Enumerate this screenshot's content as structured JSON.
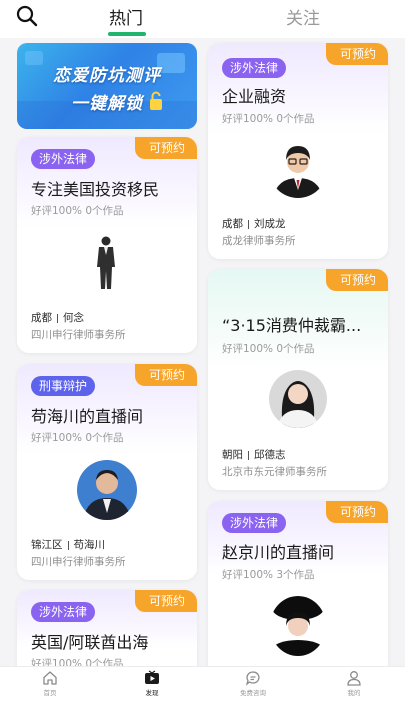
{
  "header": {
    "tabs": [
      {
        "label": "热门",
        "active": true
      },
      {
        "label": "关注",
        "active": false
      }
    ],
    "accent_color": "#1fb56c",
    "search_icon": "search-icon"
  },
  "promo_banner": {
    "line1": "恋爱防坑测评",
    "line2": "一键解锁"
  },
  "cards": [
    {
      "badge": "可预约",
      "tag": "涉外法律",
      "title": "专注美国投资移民",
      "stats": "好评100%  0个作品",
      "city": "成都",
      "name": "何念",
      "firm": "四川申行律师事务所"
    },
    {
      "badge": "可预约",
      "tag": "刑事辩护",
      "title": "苟海川的直播间",
      "stats": "好评100%  0个作品",
      "city": "锦江区",
      "name": "苟海川",
      "firm": "四川申行律师事务所"
    },
    {
      "badge": "可预约",
      "tag": "涉外法律",
      "title": "英国/阿联酋出海",
      "stats": "好评100%  0个作品"
    },
    {
      "badge": "可预约",
      "tag": "涉外法律",
      "title": "企业融资",
      "stats": "好评100%  0个作品",
      "city": "成都",
      "name": "刘成龙",
      "firm": "成龙律师事务所"
    },
    {
      "badge": "可预约",
      "title": "“3·15消费仲裁霸...",
      "stats": "好评100%  0个作品",
      "city": "朝阳",
      "name": "邱德志",
      "firm": "北京市东元律师事务所"
    },
    {
      "badge": "可预约",
      "tag": "涉外法律",
      "title": "赵京川的直播间",
      "stats": "好评100%  3个作品"
    }
  ],
  "bottom_nav": [
    {
      "label": "首页",
      "icon": "home-icon",
      "active": false
    },
    {
      "label": "发现",
      "icon": "play-icon",
      "active": true
    },
    {
      "label": "免费咨询",
      "icon": "chat-icon",
      "active": false
    },
    {
      "label": "我的",
      "icon": "user-icon",
      "active": false
    }
  ],
  "colors": {
    "badge": "#f7a42b",
    "tag_purple": "#8a63f0",
    "tag_blue": "#5d63ea"
  }
}
